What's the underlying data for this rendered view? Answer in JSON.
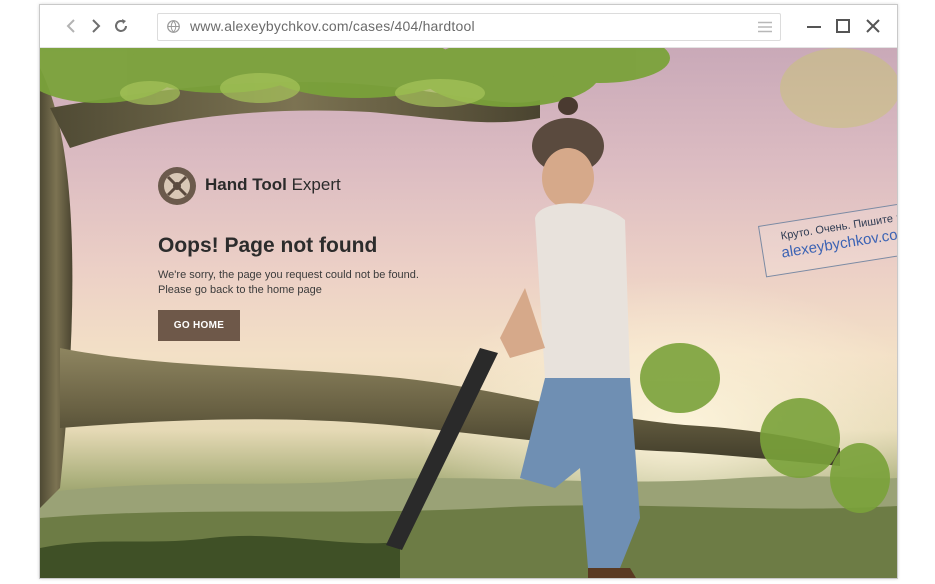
{
  "browser": {
    "url": "www.alexeybychkov.com/cases/404/hardtool",
    "back_icon": "chevron-left-icon",
    "forward_icon": "chevron-right-icon",
    "reload_icon": "reload-icon",
    "site_icon": "globe-icon",
    "menu_icon": "hamburger-icon",
    "minimize_icon": "minimize-icon",
    "maximize_icon": "maximize-icon",
    "close_icon": "close-icon"
  },
  "page": {
    "logo": {
      "brand_bold": "Hand Tool",
      "brand_light": " Expert",
      "icon": "crossed-tools-gear-icon"
    },
    "title": "Oops! Page not found",
    "message_line1": "We're sorry, the page you request could not be found.",
    "message_line2": "Please go back to the home page",
    "button_label": "GO HOME"
  },
  "stamp": {
    "line1": "Круто. Очень. Пишите :)",
    "line2": "alexeybychkov.com"
  },
  "colors": {
    "button": "#6e5849",
    "stamp_link": "#3c63b4",
    "sky_top": "#c9a9b8",
    "branch": "#6c6548",
    "leaves": "#7aa23a"
  }
}
